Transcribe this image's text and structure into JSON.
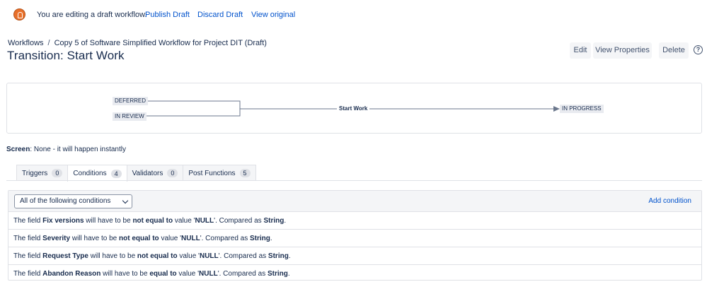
{
  "banner": {
    "message": "You are editing a draft workflow.",
    "publish": "Publish Draft",
    "discard": "Discard Draft",
    "view_original": "View original"
  },
  "breadcrumb": {
    "root": "Workflows",
    "separator": "/",
    "current": "Copy 5 of Software Simplified Workflow for Project DIT (Draft)"
  },
  "title": "Transition: Start Work",
  "actions": {
    "edit": "Edit",
    "view_properties": "View Properties",
    "delete": "Delete",
    "help": "?"
  },
  "diagram": {
    "from": [
      "DEFERRED",
      "IN REVIEW"
    ],
    "transition": "Start Work",
    "to": "IN PROGRESS"
  },
  "screen": {
    "label": "Screen",
    "value": ": None - it will happen instantly"
  },
  "tabs": [
    {
      "label": "Triggers",
      "count": "0"
    },
    {
      "label": "Conditions",
      "count": "4"
    },
    {
      "label": "Validators",
      "count": "0"
    },
    {
      "label": "Post Functions",
      "count": "5"
    }
  ],
  "conditions": {
    "select_value": "All of the following conditions",
    "add_label": "Add condition",
    "rows": [
      {
        "p1": "The field ",
        "field": "Fix versions",
        "p2": " will have to be ",
        "op": "not equal to",
        "p3": " value '",
        "value": "NULL",
        "p4": "'. Compared as ",
        "type": "String",
        "p5": "."
      },
      {
        "p1": "The field ",
        "field": "Severity",
        "p2": " will have to be ",
        "op": "not equal to",
        "p3": " value '",
        "value": "NULL",
        "p4": "'. Compared as ",
        "type": "String",
        "p5": "."
      },
      {
        "p1": "The field ",
        "field": "Request Type",
        "p2": " will have to be ",
        "op": "not equal to",
        "p3": " value '",
        "value": "NULL",
        "p4": "'. Compared as ",
        "type": "String",
        "p5": "."
      },
      {
        "p1": "The field ",
        "field": "Abandon Reason",
        "p2": " will have to be ",
        "op": "equal to",
        "p3": " value '",
        "value": "NULL",
        "p4": "'. Compared as ",
        "type": "String",
        "p5": "."
      }
    ]
  },
  "colors": {
    "link": "#0052cc",
    "text": "#172b4d",
    "avatar": "#e8702a",
    "border": "#dfe1e6"
  }
}
